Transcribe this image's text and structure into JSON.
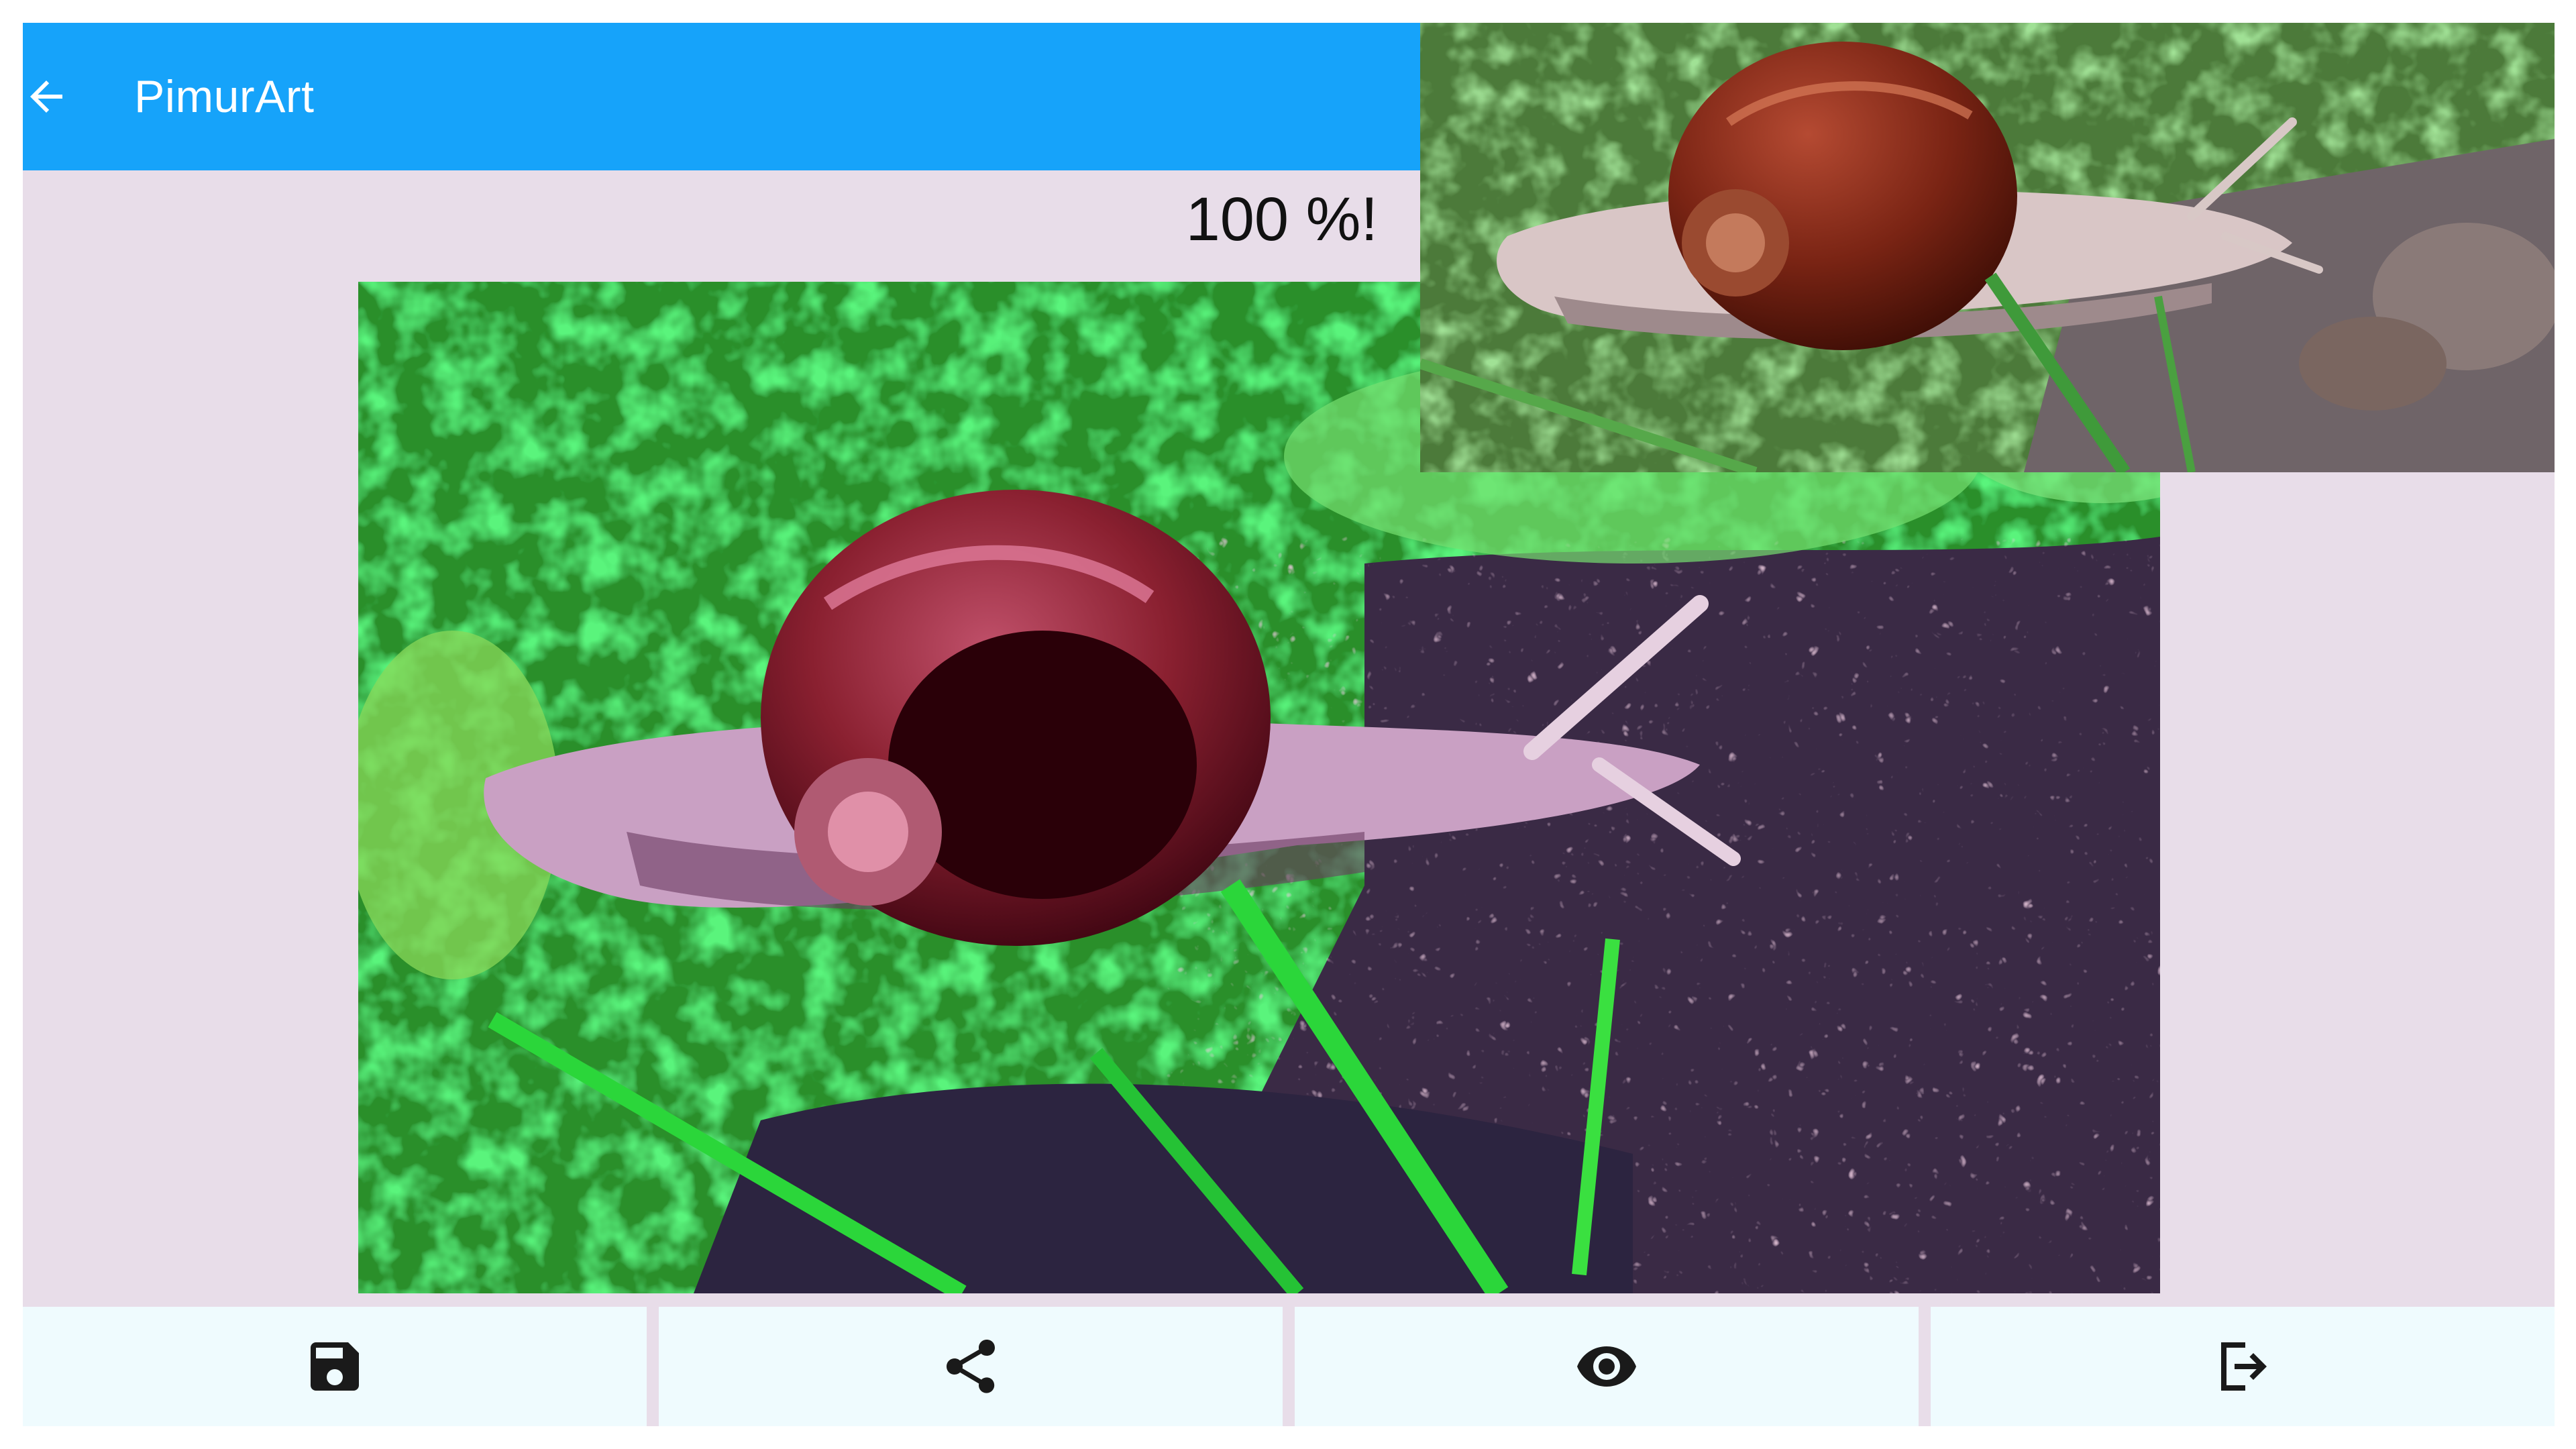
{
  "app": {
    "title": "PimurArt"
  },
  "status": {
    "progress_text": "100 %!",
    "progress_percent": 100
  },
  "images": {
    "processed": {
      "subject": "snail",
      "style": "posterized"
    },
    "original": {
      "subject": "snail",
      "style": "photo"
    }
  },
  "toolbar": {
    "buttons": [
      {
        "id": "save",
        "icon": "save-icon"
      },
      {
        "id": "share",
        "icon": "share-icon"
      },
      {
        "id": "preview",
        "icon": "eye-icon"
      },
      {
        "id": "exit",
        "icon": "exit-icon"
      }
    ]
  },
  "colors": {
    "appbar": "#16a3fa",
    "background": "#e8dde9",
    "toolbar": "#effbfe",
    "icon": "#1a1a1a"
  }
}
